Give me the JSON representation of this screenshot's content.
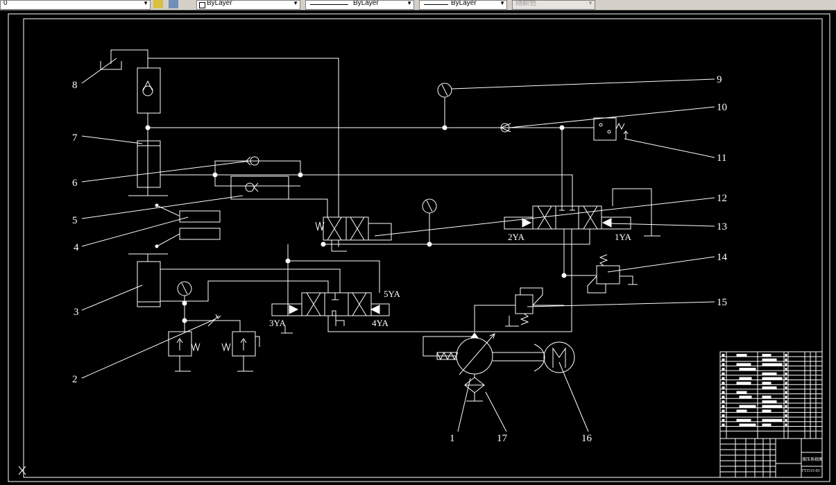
{
  "toolbar": {
    "layer": "0",
    "color": "ByLayer",
    "linetype": "ByLayer",
    "lineweight": "ByLayer",
    "plotstyle": "随颜色"
  },
  "drawing": {
    "callouts": [
      "1",
      "2",
      "3",
      "4",
      "5",
      "6",
      "7",
      "8",
      "9",
      "10",
      "11",
      "12",
      "13",
      "14",
      "15",
      "16",
      "17"
    ],
    "solenoids": {
      "s1": "1YA",
      "s2": "2YA",
      "s3": "3YA",
      "s4": "4YA",
      "s5": "5YA"
    },
    "title_block": {
      "drawing_name": "液压系统图",
      "drawing_no": "TTJ315-03"
    }
  },
  "colors": {
    "background": "#000000",
    "lines": "#ffffff",
    "toolbar": "#d4d0c8"
  }
}
